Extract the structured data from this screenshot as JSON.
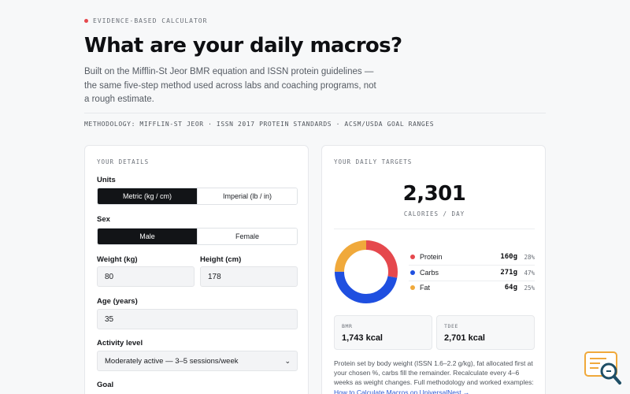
{
  "hero": {
    "eyebrow": "EVIDENCE-BASED CALCULATOR",
    "title": "What are your daily macros?",
    "subtitle": "Built on the Mifflin-St Jeor BMR equation and ISSN protein guidelines — the same five-step method used across labs and coaching programs, not a rough estimate.",
    "methodology": "METHODOLOGY: MIFFLIN-ST JEOR · ISSN 2017 PROTEIN STANDARDS · ACSM/USDA GOAL RANGES"
  },
  "details": {
    "label": "YOUR DETAILS",
    "units_label": "Units",
    "units_options": [
      "Metric (kg / cm)",
      "Imperial (lb / in)"
    ],
    "units_selected": "Metric (kg / cm)",
    "sex_label": "Sex",
    "sex_options": [
      "Male",
      "Female"
    ],
    "sex_selected": "Male",
    "weight_label": "Weight (kg)",
    "weight_value": "80",
    "height_label": "Height (cm)",
    "height_value": "178",
    "age_label": "Age (years)",
    "age_value": "35",
    "activity_label": "Activity level",
    "activity_value": "Moderately active — 3–5 sessions/week",
    "goal_label": "Goal"
  },
  "targets": {
    "label": "YOUR DAILY TARGETS",
    "calories": "2,301",
    "calories_unit": "CALORIES / DAY",
    "macros": [
      {
        "name": "Protein",
        "grams": "160g",
        "percent": "28%",
        "color": "#e5484d",
        "fraction": 0.28
      },
      {
        "name": "Carbs",
        "grams": "271g",
        "percent": "47%",
        "color": "#1f4fe0",
        "fraction": 0.47
      },
      {
        "name": "Fat",
        "grams": "64g",
        "percent": "25%",
        "color": "#f0a93b",
        "fraction": 0.25
      }
    ],
    "bmr_label": "BMR",
    "bmr_value": "1,743 kcal",
    "tdee_label": "TDEE",
    "tdee_value": "2,701 kcal",
    "note": "Protein set by body weight (ISSN 1.6–2.2 g/kg), fat allocated first at your chosen %, carbs fill the remainder. Recalculate every 4–6 weeks as weight changes. Full methodology and worked examples:",
    "link": "How to Calculate Macros on UniversalNest →"
  }
}
